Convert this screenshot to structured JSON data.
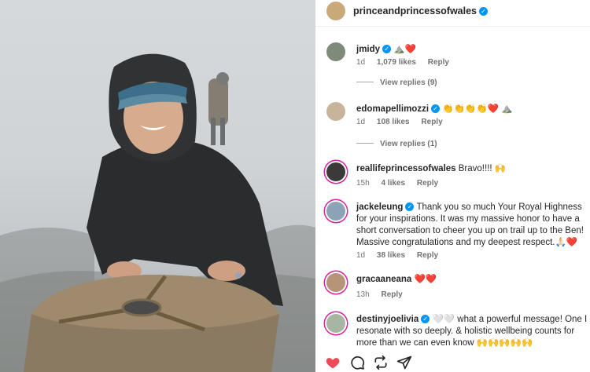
{
  "post": {
    "author": "princeandprincessofwales"
  },
  "comments": [
    {
      "user": "jmidy",
      "verified": true,
      "text": "",
      "emoji": "⛰️❤️",
      "time": "1d",
      "likes": "1,079 likes",
      "reply": "Reply",
      "view_replies": "View replies (9)"
    },
    {
      "user": "edomapellimozzi",
      "verified": true,
      "text": "",
      "emoji": "👏👏👏👏❤️ ⛰️",
      "time": "1d",
      "likes": "108 likes",
      "reply": "Reply",
      "view_replies": "View replies (1)"
    },
    {
      "user": "reallifeprincessofwales",
      "verified": false,
      "text": "Bravo!!!! 🙌",
      "time": "15h",
      "likes": "4 likes",
      "reply": "Reply"
    },
    {
      "user": "jackeleung",
      "verified": true,
      "text": "Thank you so much Your Royal Highness for your inspirations. It was my massive honor to have a short conversation to cheer you up on trail up to the Ben! Massive congratulations and my deepest respect.🙏🏻❤️",
      "time": "1d",
      "likes": "38 likes",
      "reply": "Reply"
    },
    {
      "user": "gracaaneana",
      "verified": false,
      "text": "❤️❤️",
      "time": "13h",
      "likes": "",
      "reply": "Reply"
    },
    {
      "user": "destinyjoelivia",
      "verified": true,
      "text": "🤍🤍 what a powerful message! One I resonate with so deeply. & holistic wellbeing counts for more than we can even know 🙌🙌🙌🙌🙌",
      "time": "",
      "likes": "",
      "reply": ""
    }
  ],
  "actions": {
    "icons": [
      "heart-icon",
      "comment-icon",
      "repost-icon",
      "share-icon"
    ],
    "like_color": "#ed4956"
  },
  "colors": {
    "verified": "#0095f6",
    "meta": "#737373",
    "text": "#262626"
  }
}
